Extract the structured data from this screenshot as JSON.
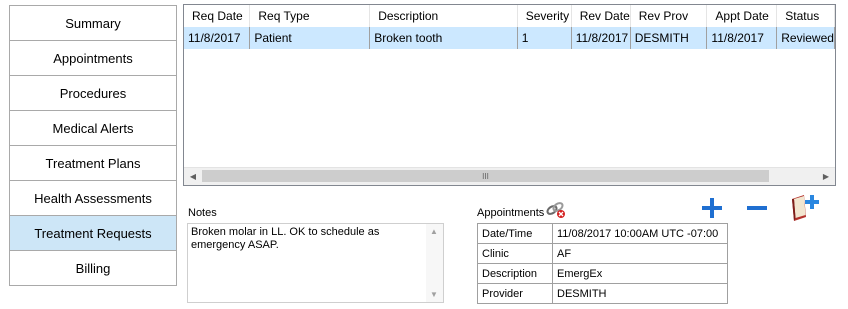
{
  "nav": {
    "items": [
      {
        "label": "Summary"
      },
      {
        "label": "Appointments"
      },
      {
        "label": "Procedures"
      },
      {
        "label": "Medical Alerts"
      },
      {
        "label": "Treatment Plans"
      },
      {
        "label": "Health Assessments"
      },
      {
        "label": "Treatment Requests",
        "active": true
      },
      {
        "label": "Billing"
      }
    ]
  },
  "grid": {
    "columns": [
      "Req Date",
      "Req Type",
      "Description",
      "Severity",
      "Rev Date",
      "Rev Prov",
      "Appt Date",
      "Status"
    ],
    "rows": [
      [
        "11/8/2017",
        "Patient",
        "Broken tooth",
        "1",
        "11/8/2017",
        "DESMITH",
        "11/8/2017",
        "Reviewed"
      ]
    ],
    "scroll_thumb_glyph": "III"
  },
  "notes": {
    "label": "Notes",
    "text": "Broken molar in LL. OK to schedule as emergency ASAP."
  },
  "appointments": {
    "label": "Appointments",
    "icon": "unlink-chain-icon",
    "fields": [
      {
        "key": "Date/Time",
        "value": "11/08/2017 10:00AM UTC -07:00"
      },
      {
        "key": "Clinic",
        "value": "AF"
      },
      {
        "key": "Description",
        "value": "EmergEx"
      },
      {
        "key": "Provider",
        "value": "DESMITH"
      }
    ]
  },
  "actions": {
    "add_icon": "plus-icon",
    "remove_icon": "minus-icon",
    "book_icon": "book-add-icon",
    "accent": "#1f6fd1"
  }
}
